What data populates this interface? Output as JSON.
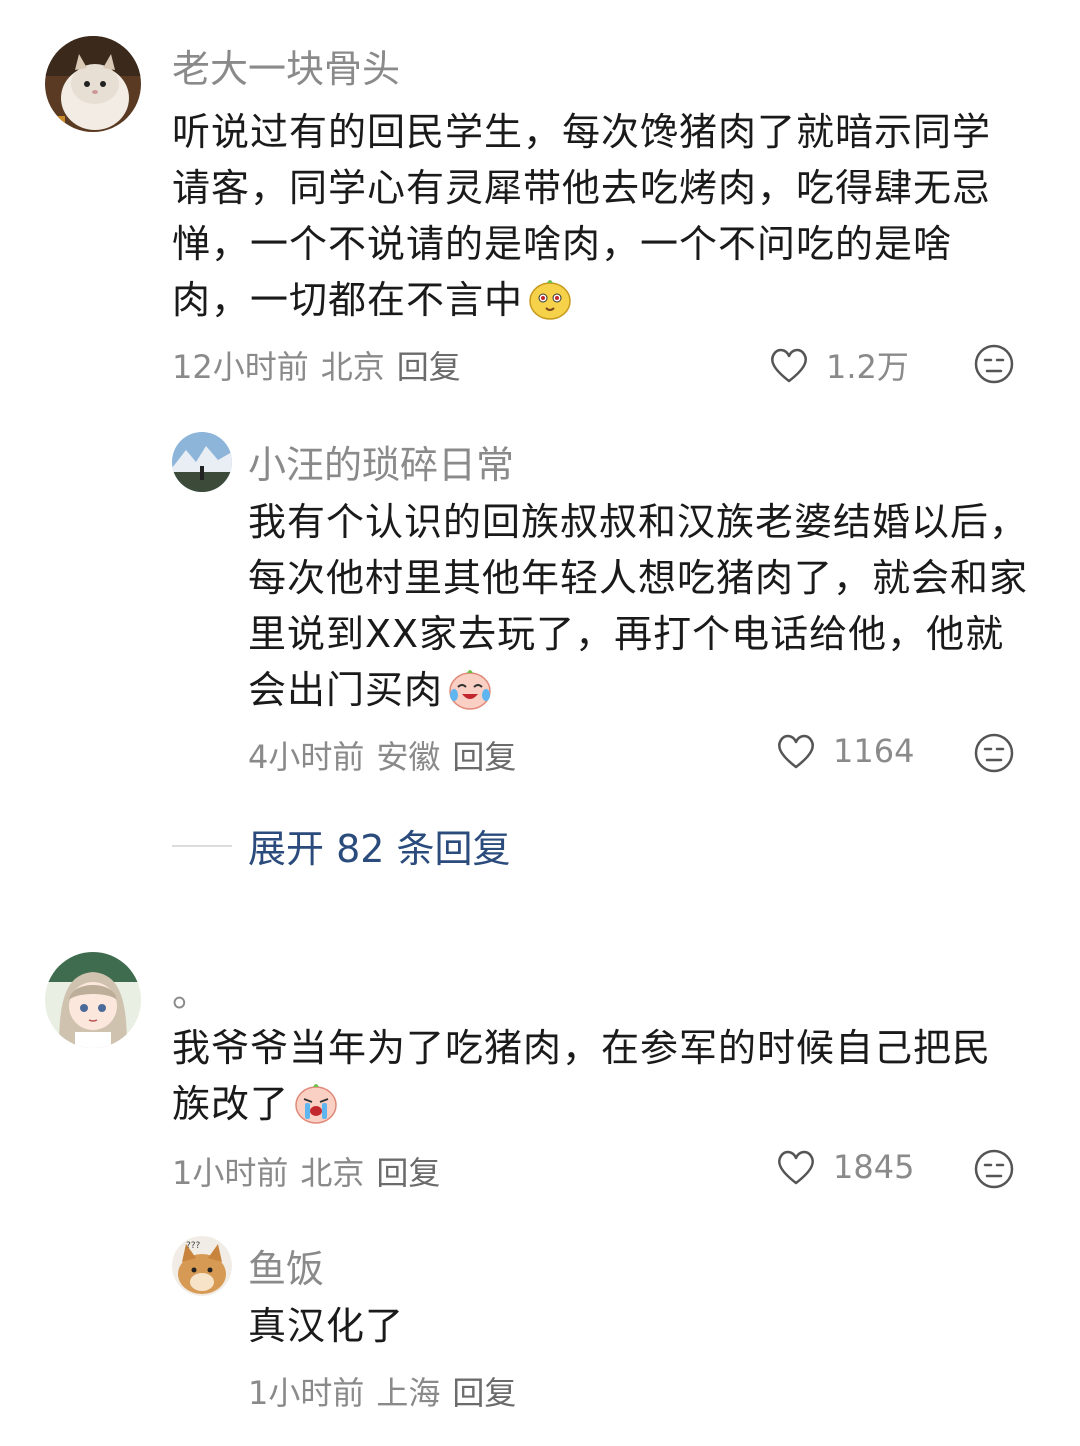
{
  "comments": [
    {
      "username": "老大一块骨头",
      "text": "听说过有的回民学生，每次馋猪肉了就暗示同学请客，同学心有灵犀带他去吃烤肉，吃得肆无忌惮，一个不说请的是啥肉，一个不问吃的是啥肉，一切都在不言中",
      "time": "12小时前",
      "location": "北京",
      "reply_label": "回复",
      "likes": "1.2万",
      "emoji": "cute-face-emoji"
    },
    {
      "username": "小汪的琐碎日常",
      "text": "我有个认识的回族叔叔和汉族老婆结婚以后，每次他村里其他年轻人想吃猪肉了，就会和家里说到XX家去玩了，再打个电话给他，他就会出门买肉",
      "time": "4小时前",
      "location": "安徽",
      "reply_label": "回复",
      "likes": "1164",
      "emoji": "laugh-cry-emoji"
    },
    {
      "username": "。",
      "text": "我爷爷当年为了吃猪肉，在参军的时候自己把民族改了",
      "time": "1小时前",
      "location": "北京",
      "reply_label": "回复",
      "likes": "1845",
      "emoji": "crying-emoji"
    },
    {
      "username": "鱼饭",
      "text": "真汉化了",
      "time": "1小时前",
      "location": "上海",
      "reply_label": "回复"
    }
  ],
  "expand_replies": "展开 82 条回复"
}
